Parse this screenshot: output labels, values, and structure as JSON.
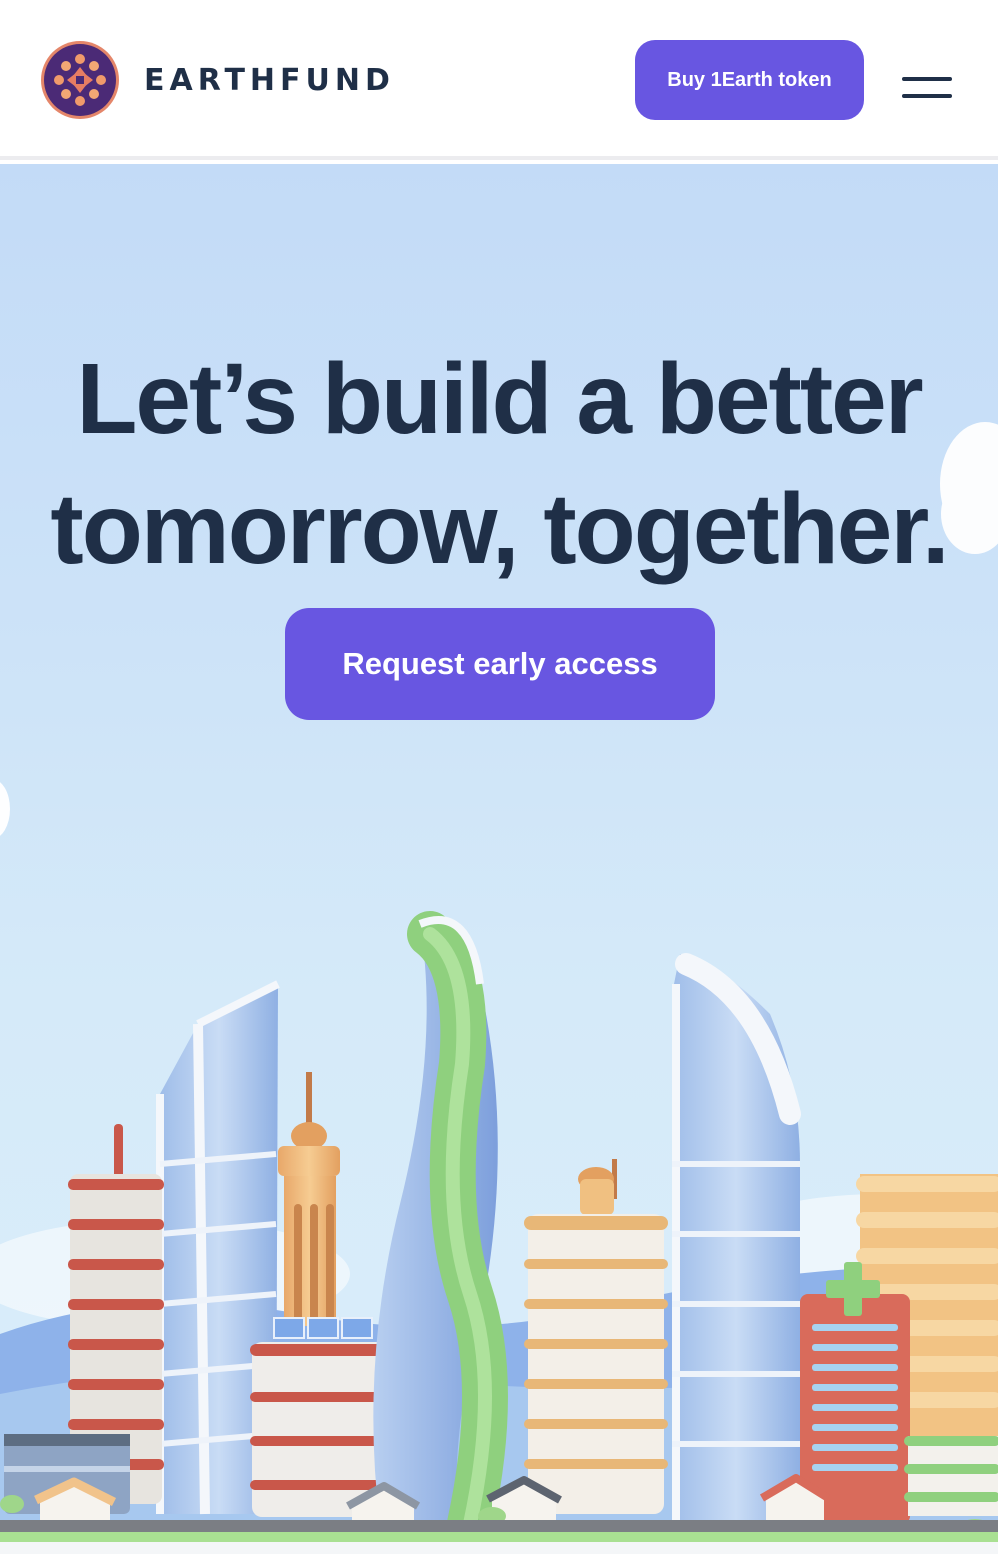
{
  "brand": {
    "logo_icon": "earthfund-logo-icon",
    "name": "EARTHFUND"
  },
  "header": {
    "buy_button_label": "Buy 1Earth token",
    "menu_icon": "hamburger-menu-icon"
  },
  "hero": {
    "title_line_1": "Let’s build a better",
    "title_line_2": "tomorrow, together.",
    "cta_label": "Request early access",
    "illustration": "city-skyline-illustration"
  },
  "colors": {
    "accent": "#6856e1",
    "text_dark": "#1f2f47",
    "sky": "#c3dbf7",
    "logo_dark": "#4b2a76",
    "logo_ring": "#e4866a"
  }
}
